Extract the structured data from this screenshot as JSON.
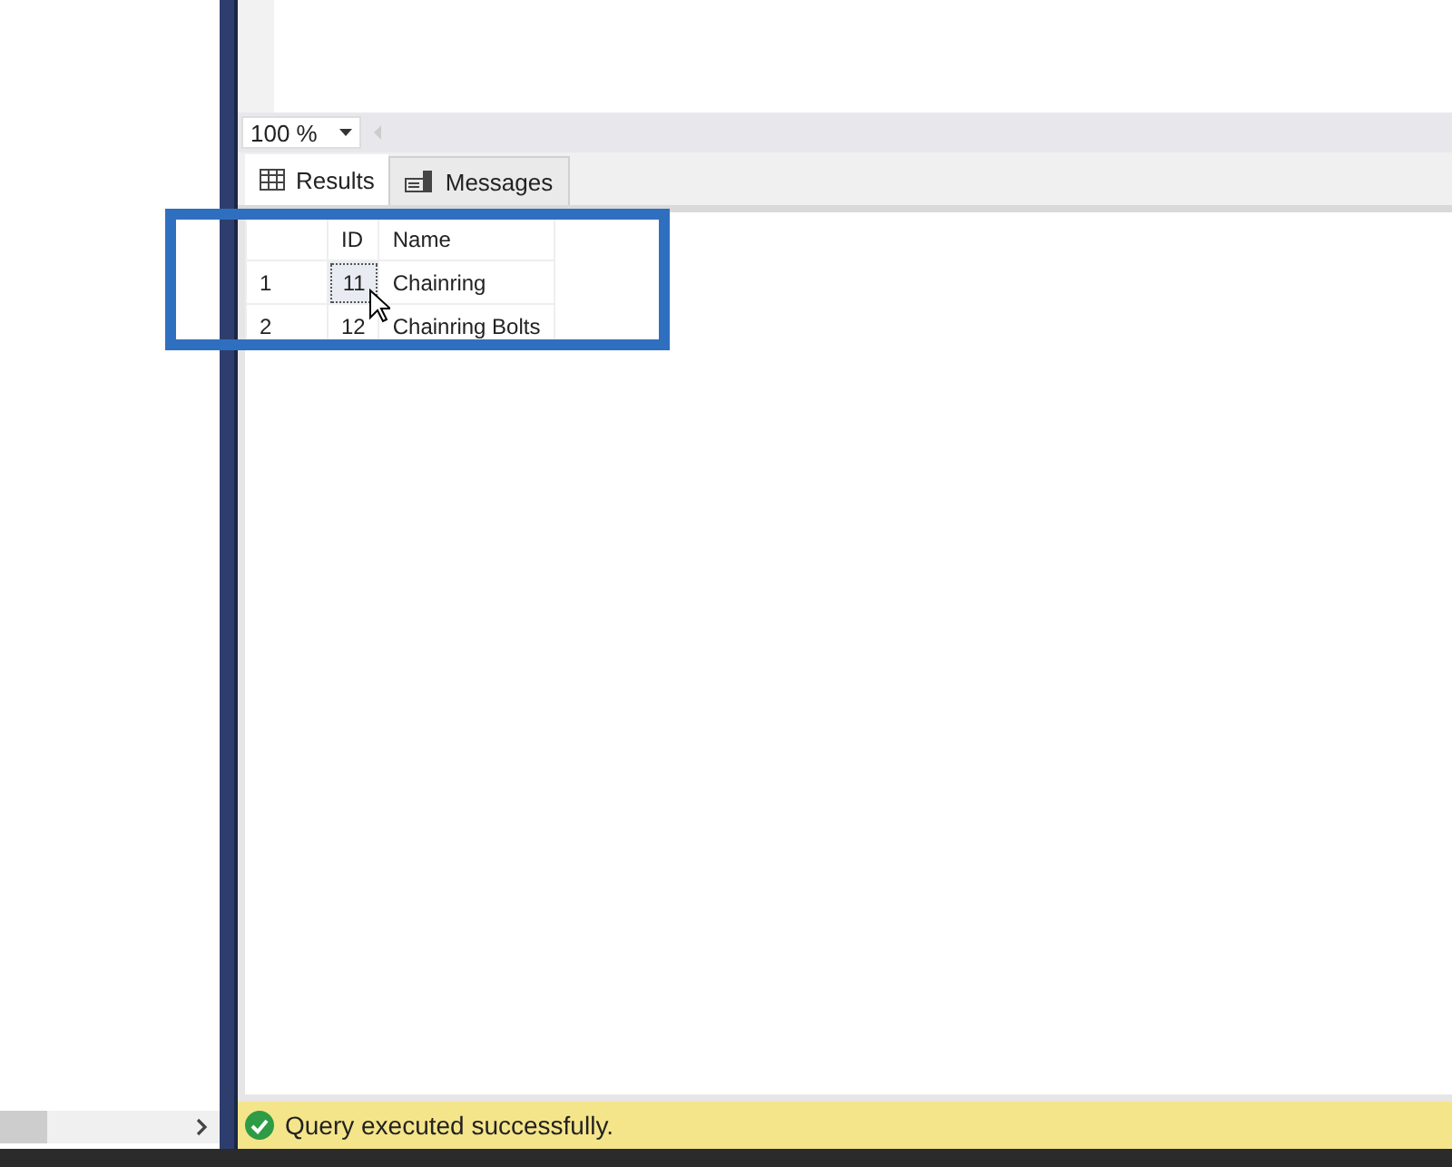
{
  "zoom": {
    "value": "100 %"
  },
  "tabs": [
    {
      "label": "Results",
      "kind": "grid",
      "selected": true
    },
    {
      "label": "Messages",
      "kind": "messages",
      "selected": false
    }
  ],
  "table": {
    "columns": [
      "ID",
      "Name"
    ],
    "rows": [
      {
        "number": "1",
        "cells": [
          "11",
          "Chainring"
        ],
        "selected": true
      },
      {
        "number": "2",
        "cells": [
          "12",
          "Chainring Bolts"
        ],
        "selected": false
      }
    ]
  },
  "status_bar": {
    "message": "Query executed successfully."
  }
}
